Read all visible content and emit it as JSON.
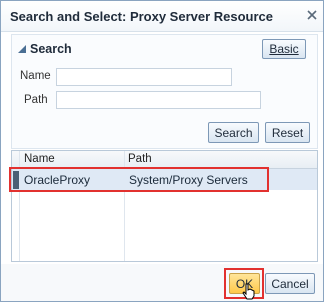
{
  "dialog": {
    "title": "Search and Select: Proxy Server Resource",
    "search_heading": "Search",
    "basic_label": "Basic",
    "name_label": "Name",
    "path_label": "Path",
    "name_value": "",
    "path_value": "",
    "search_button": "Search",
    "reset_button": "Reset",
    "table": {
      "headers": [
        "Name",
        "Path"
      ],
      "rows": [
        {
          "name": "OracleProxy",
          "path": "System/Proxy Servers"
        }
      ]
    },
    "ok_button": "OK",
    "cancel_button": "Cancel"
  },
  "colors": {
    "highlight": "#e2312f",
    "ok_background": "#ffd56a",
    "selected_row": "#dfe9f5"
  },
  "icons": [
    "close-icon",
    "collapse-triangle-icon",
    "mouse-cursor-icon"
  ]
}
